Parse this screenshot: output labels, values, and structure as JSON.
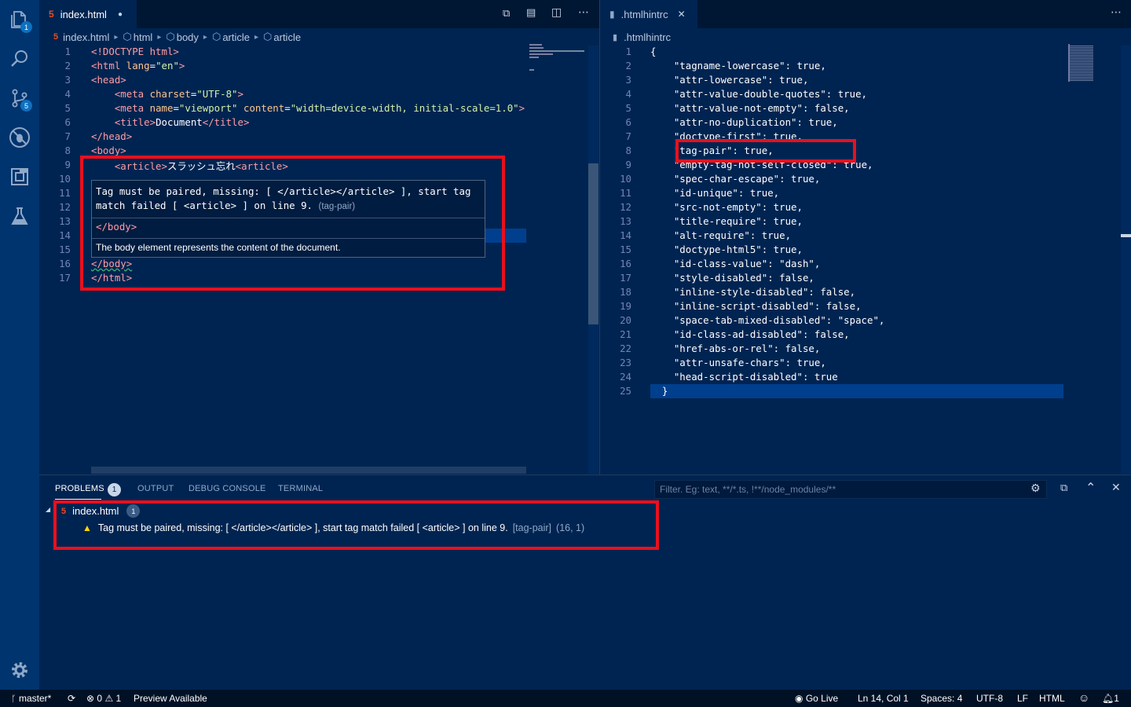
{
  "activity_bar": {
    "explorer_badge": "1",
    "scm_badge": "5"
  },
  "left_editor": {
    "tab_label": "index.html",
    "breadcrumb": [
      "index.html",
      "html",
      "body",
      "article",
      "article"
    ],
    "lines": [
      [
        {
          "c": "tg",
          "t": "<!DOCTYPE html>"
        }
      ],
      [
        {
          "c": "tg",
          "t": "<html "
        },
        {
          "c": "at",
          "t": "lang"
        },
        {
          "c": "tx",
          "t": "="
        },
        {
          "c": "st",
          "t": "\"en\""
        },
        {
          "c": "tg",
          "t": ">"
        }
      ],
      [
        {
          "c": "tg",
          "t": "<head>"
        }
      ],
      [
        {
          "c": "tx",
          "t": "    "
        },
        {
          "c": "tg",
          "t": "<meta "
        },
        {
          "c": "at",
          "t": "charset"
        },
        {
          "c": "tx",
          "t": "="
        },
        {
          "c": "st",
          "t": "\"UTF-8\""
        },
        {
          "c": "tg",
          "t": ">"
        }
      ],
      [
        {
          "c": "tx",
          "t": "    "
        },
        {
          "c": "tg",
          "t": "<meta "
        },
        {
          "c": "at",
          "t": "name"
        },
        {
          "c": "tx",
          "t": "="
        },
        {
          "c": "st",
          "t": "\"viewport\""
        },
        {
          "c": "at",
          "t": " content"
        },
        {
          "c": "tx",
          "t": "="
        },
        {
          "c": "st",
          "t": "\"width=device-width, initial-scale=1.0\""
        },
        {
          "c": "tg",
          "t": ">"
        }
      ],
      [
        {
          "c": "tx",
          "t": "    "
        },
        {
          "c": "tg",
          "t": "<title>"
        },
        {
          "c": "tx",
          "t": "Document"
        },
        {
          "c": "tg",
          "t": "</title>"
        }
      ],
      [
        {
          "c": "tg",
          "t": "</head>"
        }
      ],
      [
        {
          "c": "tg",
          "t": "<body>"
        }
      ],
      [
        {
          "c": "tx",
          "t": "    "
        },
        {
          "c": "tg",
          "t": "<article>"
        },
        {
          "c": "tx",
          "t": "スラッシュ忘れ"
        },
        {
          "c": "tg",
          "t": "<article>"
        }
      ],
      [],
      [],
      [],
      [],
      [],
      [],
      [
        {
          "c": "tg",
          "t": "</body>"
        }
      ],
      [
        {
          "c": "tg",
          "t": "</html>"
        }
      ]
    ],
    "hover": {
      "message_line1": "Tag must be paired, missing: [ </article></article> ], start tag",
      "message_line2": "match failed [ <article> ] on line 9.",
      "rule": "(tag-pair)",
      "code_snippet": "</body>",
      "description": "The body element represents the content of the document."
    }
  },
  "right_editor": {
    "tab_label": ".htmlhintrc",
    "breadcrumb": ".htmlhintrc",
    "lines": [
      "{",
      "    \"tagname-lowercase\": true,",
      "    \"attr-lowercase\": true,",
      "    \"attr-value-double-quotes\": true,",
      "    \"attr-value-not-empty\": false,",
      "    \"attr-no-duplication\": true,",
      "    \"doctype-first\": true,",
      "    \"tag-pair\": true,",
      "    \"empty-tag-not-self-closed\": true,",
      "    \"spec-char-escape\": true,",
      "    \"id-unique\": true,",
      "    \"src-not-empty\": true,",
      "    \"title-require\": true,",
      "    \"alt-require\": true,",
      "    \"doctype-html5\": true,",
      "    \"id-class-value\": \"dash\",",
      "    \"style-disabled\": false,",
      "    \"inline-style-disabled\": false,",
      "    \"inline-script-disabled\": false,",
      "    \"space-tab-mixed-disabled\": \"space\",",
      "    \"id-class-ad-disabled\": false,",
      "    \"href-abs-or-rel\": false,",
      "    \"attr-unsafe-chars\": true,",
      "    \"head-script-disabled\": true",
      "  }"
    ]
  },
  "panel": {
    "tabs": [
      "PROBLEMS",
      "OUTPUT",
      "DEBUG CONSOLE",
      "TERMINAL"
    ],
    "problems_count": "1",
    "filter_placeholder": "Filter. Eg: text, **/*.ts, !**/node_modules/**",
    "file": "index.html",
    "file_count": "1",
    "problem_message": "Tag must be paired, missing: [ </article></article> ], start tag match failed [ <article> ] on line 9.",
    "problem_rule": "[tag-pair]",
    "problem_location": "(16, 1)"
  },
  "status_bar": {
    "branch": "master*",
    "errors": "0",
    "warnings": "1",
    "preview": "Preview Available",
    "go_live": "Go Live",
    "position": "Ln 14, Col 1",
    "spaces": "Spaces: 4",
    "encoding": "UTF-8",
    "eol": "LF",
    "language": "HTML",
    "notifications": "1"
  },
  "colors": {
    "background": "#002451",
    "highlight_box": "#e8101d",
    "warning": "#ffd700"
  }
}
